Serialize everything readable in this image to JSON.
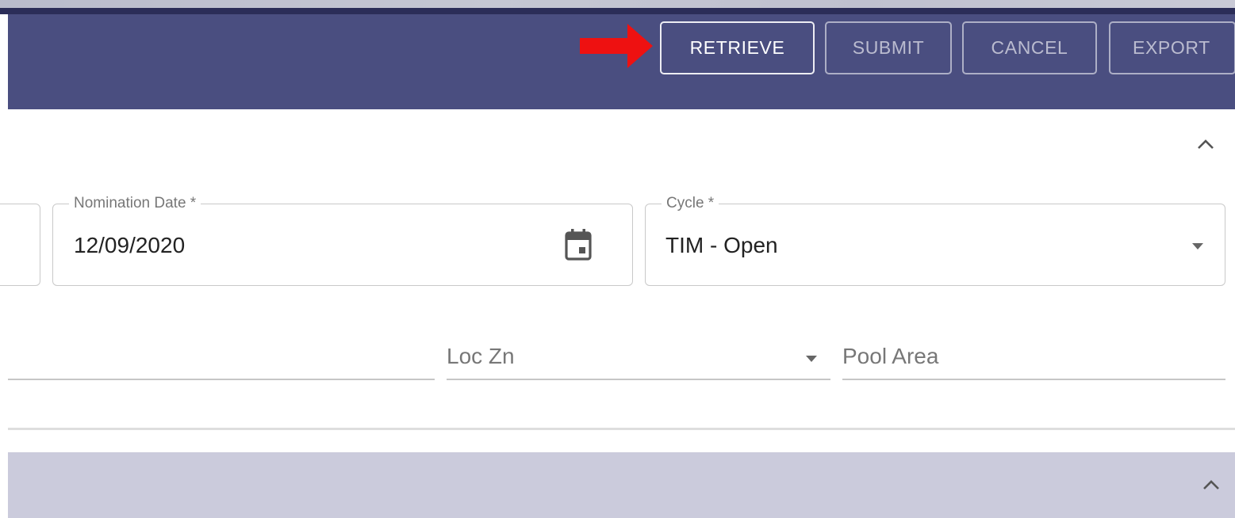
{
  "toolbar": {
    "buttons": {
      "retrieve": "RETRIEVE",
      "submit": "SUBMIT",
      "cancel": "CANCEL",
      "export": "EXPORT"
    },
    "accent_color": "#4a4e80",
    "highlight_arrow_color": "#ee1111"
  },
  "form": {
    "nomination_date": {
      "label": "Nomination Date *",
      "value": "12/09/2020",
      "icon": "calendar-icon"
    },
    "cycle": {
      "label": "Cycle *",
      "value": "TIM - Open",
      "icon": "dropdown-caret-icon"
    },
    "loc_zn": {
      "placeholder": "Loc Zn",
      "icon": "dropdown-caret-icon"
    },
    "pool_area": {
      "placeholder": "Pool Area"
    }
  },
  "icons": {
    "collapse": "chevron-up-icon",
    "indicator": "red-arrow-icon"
  }
}
